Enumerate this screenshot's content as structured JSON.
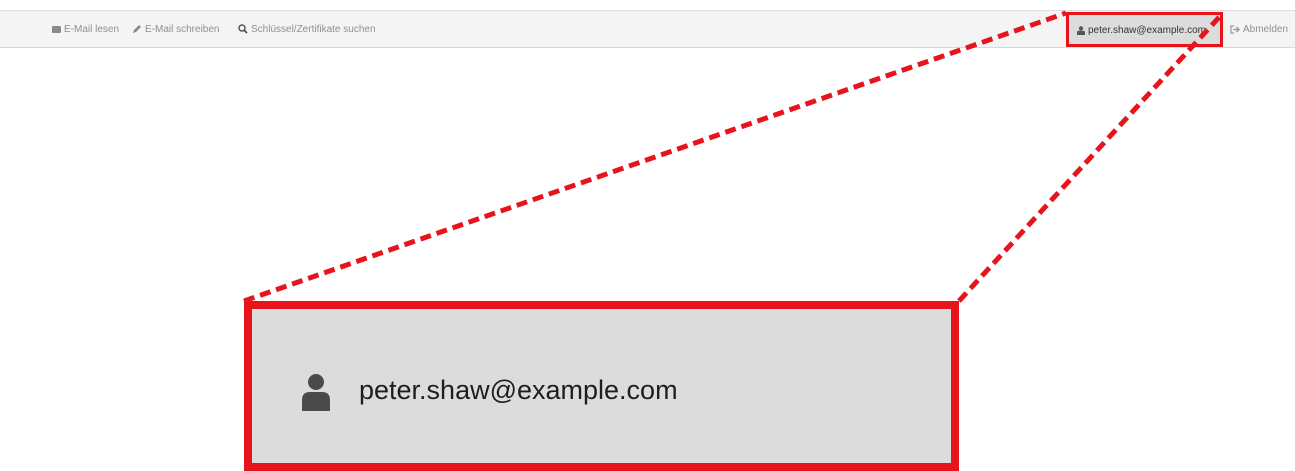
{
  "navbar": {
    "read_mail": "E-Mail lesen",
    "write_mail": "E-Mail schreiben",
    "search_keys": "Schlüssel/Zertifikate suchen",
    "user": "peter.shaw@example.com",
    "logout": "Abmelden"
  },
  "zoom": {
    "user": "peter.shaw@example.com"
  },
  "icons": {
    "read_mail": "envelope-icon",
    "write_mail": "pencil-icon",
    "search_keys": "search-icon",
    "user": "user-icon",
    "logout": "sign-out-icon"
  },
  "colors": {
    "highlight": "#e8141c",
    "navbar_bg": "#f4f4f4",
    "active_item_bg": "#dcdcdc",
    "nav_text": "#8f8f8f"
  }
}
